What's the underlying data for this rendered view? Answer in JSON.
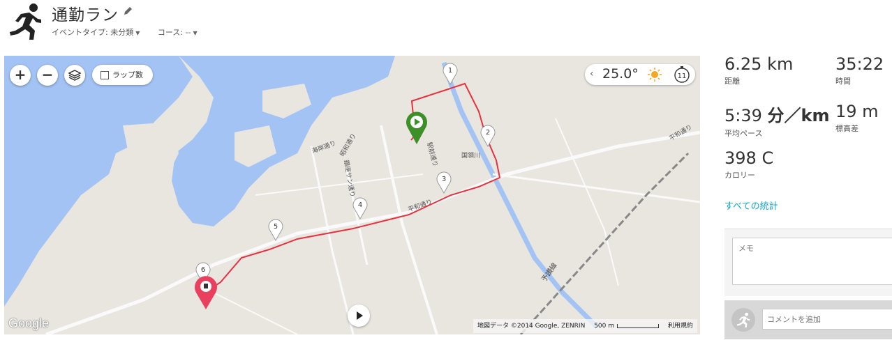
{
  "header": {
    "title": "通勤ラン",
    "event_type": "イベントタイプ: 未分類",
    "course": "コース: --"
  },
  "map": {
    "lap_toggle_label": "ラップ数",
    "temperature": "25.0°",
    "weather_icon": "sun-icon",
    "timer_number": "11",
    "google_logo": "Google",
    "attribution": "地図データ ©2014 Google, ZENRIN",
    "scale": "500 m",
    "terms": "利用規約",
    "lap_markers": [
      "1",
      "2",
      "3",
      "4",
      "5",
      "6"
    ],
    "labels": {
      "tsuwa_kita": "海岸通り",
      "showa": "昭和通り",
      "kodai": "国領川",
      "heiwa": "平和通り",
      "heiwa_east": "平和通り",
      "ekimae": "駅前通り",
      "ginza": "銀座サン通り",
      "yosan": "予讃線"
    },
    "colors": {
      "route": "#e8313f",
      "start_pin": "#3d8f27",
      "end_pin": "#e9405e",
      "water": "#a2c3f4",
      "land": "#e9e6e0"
    }
  },
  "stats": {
    "distance_value": "6.25 km",
    "distance_label": "距離",
    "time_value": "35:22",
    "time_label": "時間",
    "pace_number": "5:39",
    "pace_unit": "分／km",
    "pace_label": "平均ペース",
    "elevation_value": "19 m",
    "elevation_label": "標高差",
    "calories_value": "398 C",
    "calories_label": "カロリー",
    "all_stats_link": "すべての統計"
  },
  "notes": {
    "memo_placeholder": "メモ",
    "comment_placeholder": "コメントを追加"
  }
}
